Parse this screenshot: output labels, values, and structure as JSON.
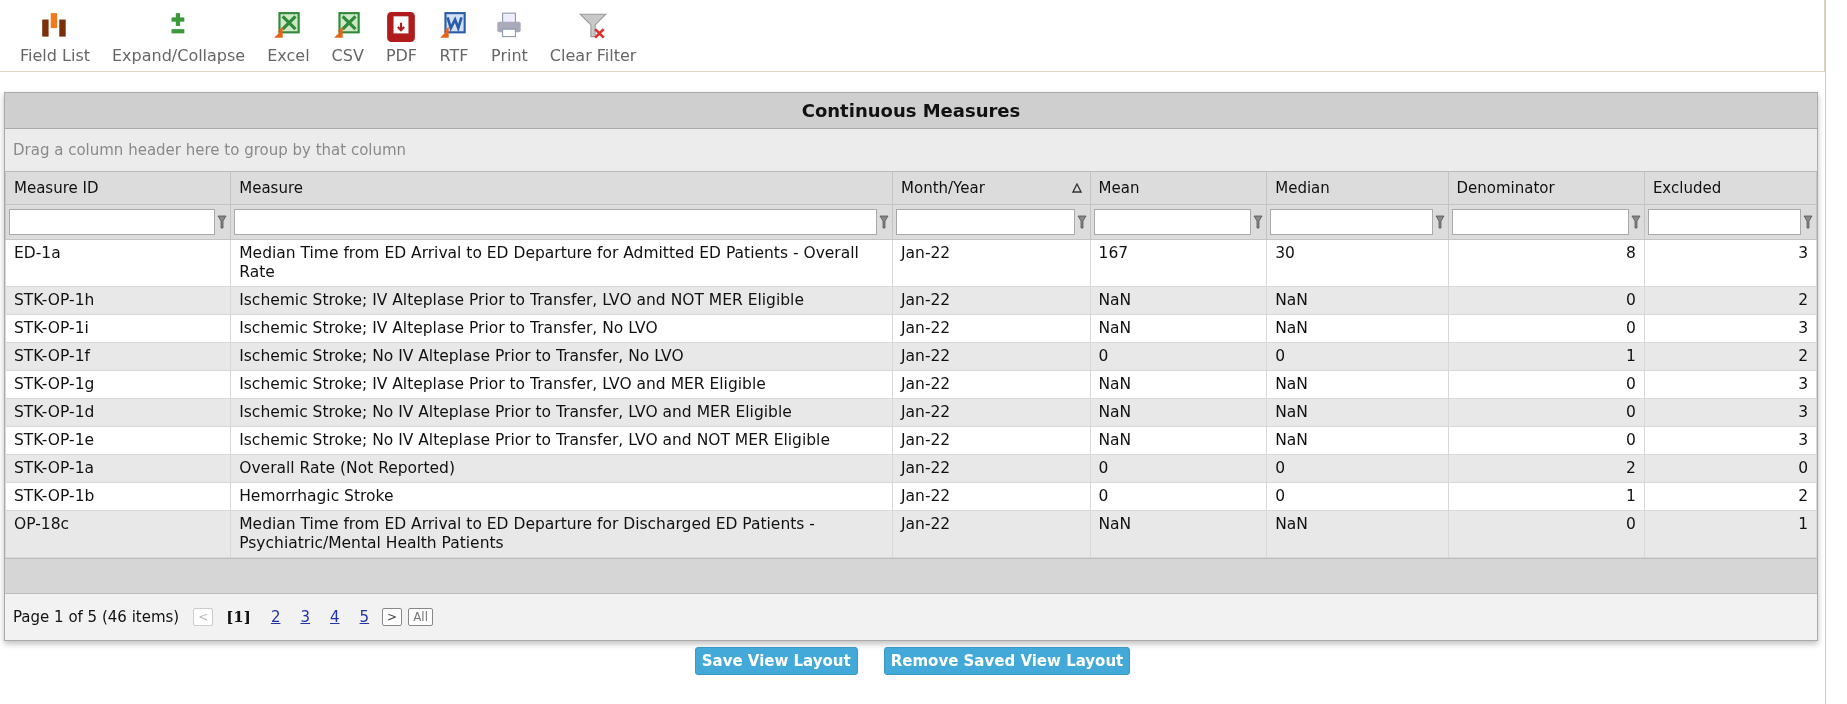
{
  "toolbar": [
    {
      "label": "Field List"
    },
    {
      "label": "Expand/Collapse"
    },
    {
      "label": "Excel"
    },
    {
      "label": "CSV"
    },
    {
      "label": "PDF"
    },
    {
      "label": "RTF"
    },
    {
      "label": "Print"
    },
    {
      "label": "Clear Filter"
    }
  ],
  "grid": {
    "title": "Continuous Measures",
    "group_panel": "Drag a column header here to group by that column",
    "columns": [
      {
        "label": "Measure ID",
        "kind": "text",
        "sorted": false
      },
      {
        "label": "Measure",
        "kind": "text",
        "sorted": false
      },
      {
        "label": "Month/Year",
        "kind": "text",
        "sorted": true
      },
      {
        "label": "Mean",
        "kind": "text",
        "sorted": false
      },
      {
        "label": "Median",
        "kind": "text",
        "sorted": false
      },
      {
        "label": "Denominator",
        "kind": "number",
        "sorted": false
      },
      {
        "label": "Excluded",
        "kind": "number",
        "sorted": false
      }
    ],
    "rows": [
      [
        "ED-1a",
        "Median Time from ED Arrival to ED Departure for Admitted ED Patients - Overall Rate",
        "Jan-22",
        "167",
        "30",
        "8",
        "3"
      ],
      [
        "STK-OP-1h",
        "Ischemic Stroke; IV Alteplase Prior to Transfer, LVO and NOT MER Eligible",
        "Jan-22",
        "NaN",
        "NaN",
        "0",
        "2"
      ],
      [
        "STK-OP-1i",
        "Ischemic Stroke; IV Alteplase Prior to Transfer, No LVO",
        "Jan-22",
        "NaN",
        "NaN",
        "0",
        "3"
      ],
      [
        "STK-OP-1f",
        "Ischemic Stroke; No IV Alteplase Prior to Transfer, No LVO",
        "Jan-22",
        "0",
        "0",
        "1",
        "2"
      ],
      [
        "STK-OP-1g",
        "Ischemic Stroke; IV Alteplase Prior to Transfer, LVO and MER Eligible",
        "Jan-22",
        "NaN",
        "NaN",
        "0",
        "3"
      ],
      [
        "STK-OP-1d",
        "Ischemic Stroke; No IV Alteplase Prior to Transfer, LVO and MER Eligible",
        "Jan-22",
        "NaN",
        "NaN",
        "0",
        "3"
      ],
      [
        "STK-OP-1e",
        "Ischemic Stroke; No IV Alteplase Prior to Transfer, LVO and NOT MER Eligible",
        "Jan-22",
        "NaN",
        "NaN",
        "0",
        "3"
      ],
      [
        "STK-OP-1a",
        "Overall Rate (Not Reported)",
        "Jan-22",
        "0",
        "0",
        "2",
        "0"
      ],
      [
        "STK-OP-1b",
        "Hemorrhagic Stroke",
        "Jan-22",
        "0",
        "0",
        "1",
        "2"
      ],
      [
        "OP-18c",
        "Median Time from ED Arrival to ED Departure for Discharged ED Patients - Psychiatric/Mental Health Patients",
        "Jan-22",
        "NaN",
        "NaN",
        "0",
        "1"
      ]
    ],
    "pager": {
      "summary": "Page 1 of 5 (46 items)",
      "prev": {
        "label": "<",
        "disabled": true
      },
      "pages": [
        {
          "label": "[1]",
          "selected": true
        },
        {
          "label": "2",
          "selected": false
        },
        {
          "label": "3",
          "selected": false
        },
        {
          "label": "4",
          "selected": false
        },
        {
          "label": "5",
          "selected": false
        }
      ],
      "next": {
        "label": ">",
        "disabled": false
      },
      "all": {
        "label": "All"
      }
    }
  },
  "buttons": [
    "Save View Layout",
    "Remove Saved View Layout"
  ]
}
